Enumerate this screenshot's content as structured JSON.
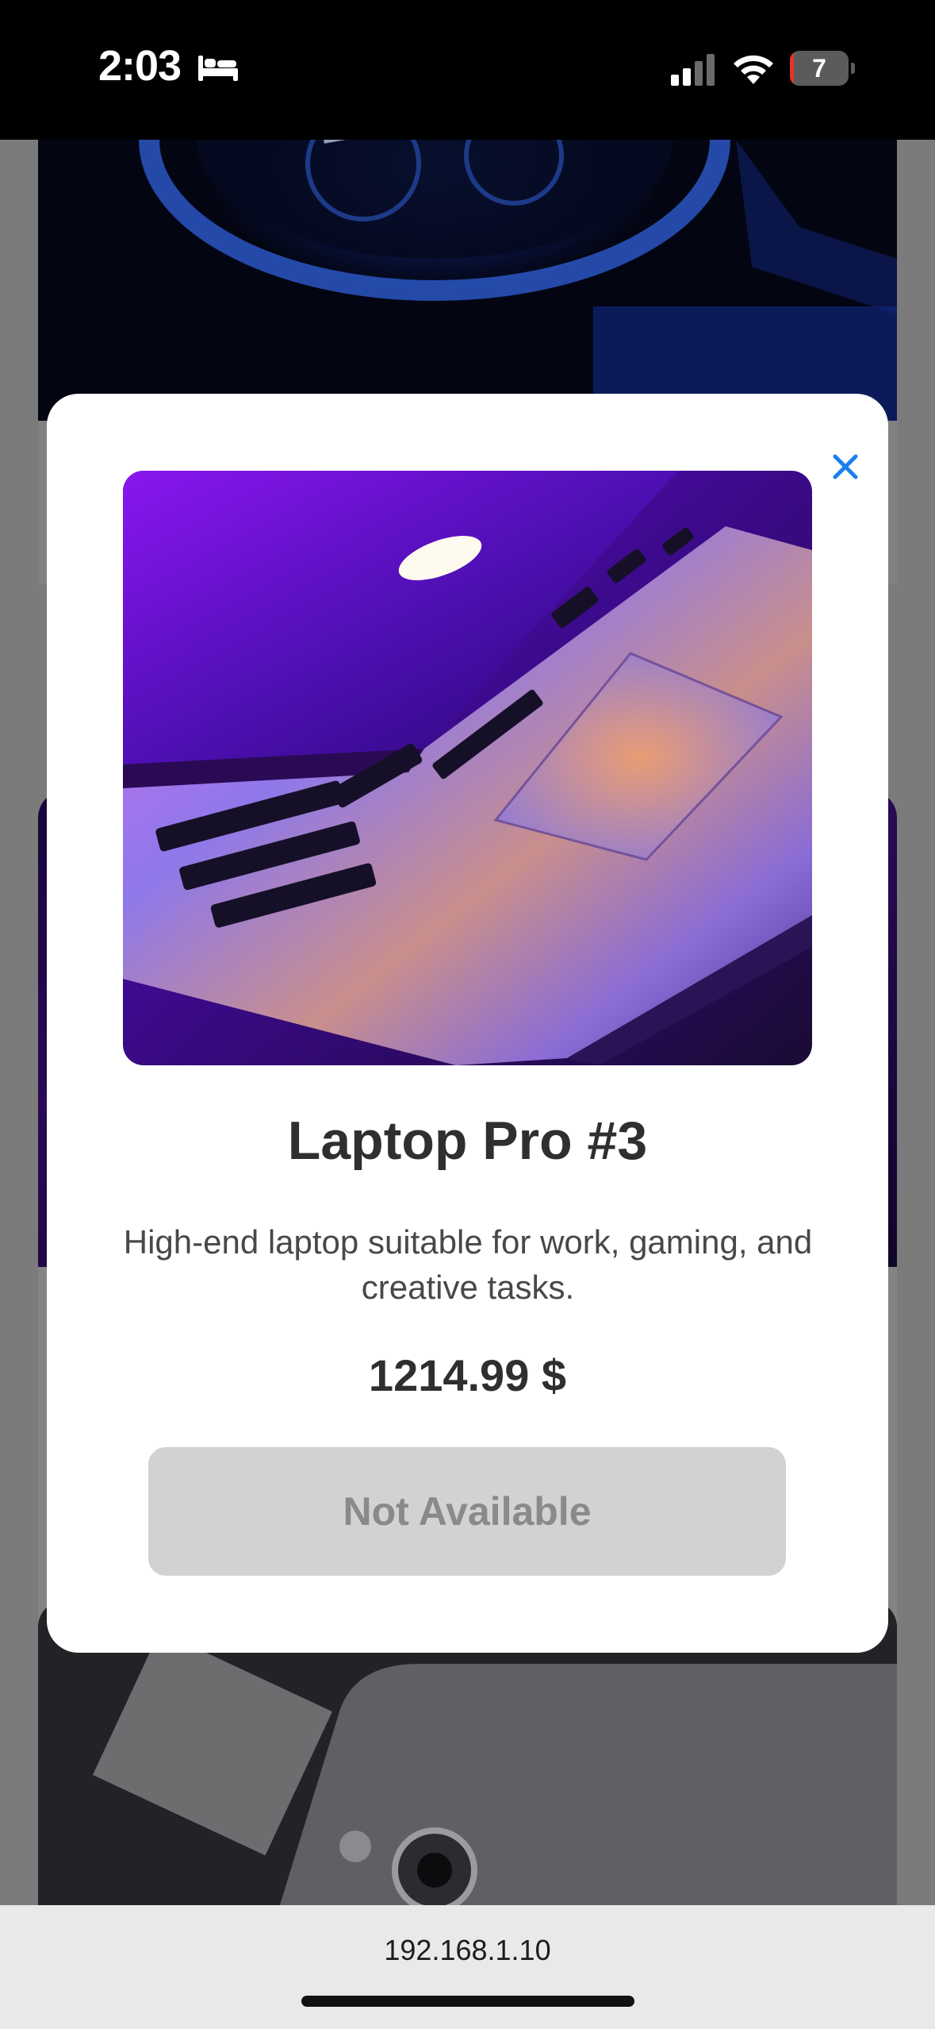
{
  "status_bar": {
    "time": "2:03",
    "battery_level": "7",
    "battery_fraction": 0.07,
    "icons": [
      "bed-icon",
      "signal-icon",
      "wifi-icon",
      "battery-icon"
    ]
  },
  "modal": {
    "close_icon": "close-icon",
    "image_alt": "laptop-product-image",
    "title": "Laptop Pro #3",
    "description": "High-end laptop suitable for work, gaming, and creative tasks.",
    "price": "1214.99 $",
    "button_label": "Not Available"
  },
  "browser": {
    "url": "192.168.1.10"
  },
  "colors": {
    "close_accent": "#1a7ff0",
    "button_disabled_bg": "#d2d2d2",
    "button_disabled_text": "#8a8a8a",
    "battery_low": "#e5342b"
  }
}
